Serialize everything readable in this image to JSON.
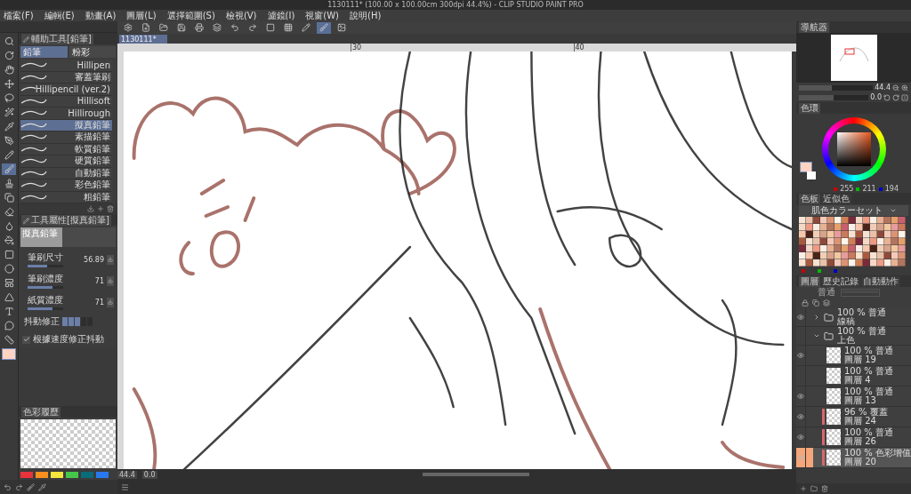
{
  "window": {
    "title": "1130111* (100.00 x 100.00cm 300dpi 44.4%) - CLIP STUDIO PAINT PRO"
  },
  "menu": [
    "檔案(F)",
    "編輯(E)",
    "動畫(A)",
    "圖層(L)",
    "選擇範圍(S)",
    "檢視(V)",
    "濾鏡(I)",
    "視窗(W)",
    "說明(H)"
  ],
  "document_tab": {
    "label": "1130111*"
  },
  "ruler": {
    "marks": [
      "30",
      "40"
    ]
  },
  "sub_tool_panel": {
    "title": "輔助工具[鉛筆]",
    "groups": [
      {
        "label": "鉛筆",
        "selected": true
      },
      {
        "label": "粉彩",
        "selected": false
      }
    ],
    "brushes": [
      {
        "name": "Hillipen",
        "selected": false
      },
      {
        "name": "審蓋筆刷",
        "selected": false
      },
      {
        "name": "Hillipencil (ver.2)",
        "selected": false
      },
      {
        "name": "Hillisoft",
        "selected": false
      },
      {
        "name": "Hillirough",
        "selected": false
      },
      {
        "name": "擬真鉛筆",
        "selected": true
      },
      {
        "name": "素描鉛筆",
        "selected": false
      },
      {
        "name": "軟質鉛筆",
        "selected": false
      },
      {
        "name": "硬質鉛筆",
        "selected": false
      },
      {
        "name": "自動鉛筆",
        "selected": false
      },
      {
        "name": "彩色鉛筆",
        "selected": false
      },
      {
        "name": "粗鉛筆",
        "selected": false
      }
    ]
  },
  "tool_property": {
    "title": "工具屬性[擬真鉛筆]",
    "preview_label": "擬真鉛筆",
    "settings": [
      {
        "kind": "slider",
        "label": "筆刷尺寸",
        "value": "56.89",
        "level": 0.55
      },
      {
        "kind": "slider",
        "label": "筆刷濃度",
        "value": "71",
        "level": 0.71
      },
      {
        "kind": "slider",
        "label": "紙質濃度",
        "value": "71",
        "level": 0.71
      },
      {
        "kind": "stabilizer",
        "label": "抖動修正",
        "level": 0.6
      },
      {
        "kind": "checkbox",
        "label": "根據速度修正抖動",
        "checked": true
      }
    ]
  },
  "color_history": {
    "title": "色彩履歷",
    "swatches": [
      {
        "color": "#e8323c"
      },
      {
        "color": "#f7901e"
      },
      {
        "color": "#f5e63c"
      },
      {
        "color": "#45c84a"
      },
      {
        "color": "#096c78"
      },
      {
        "color": "#2a78f0"
      }
    ]
  },
  "status": {
    "zoom": "44.4",
    "angle": "0.0"
  },
  "navigator": {
    "title": "導航器",
    "zoom": "44.4",
    "angle": "0.0",
    "zoom_slider": {
      "level": 0.45
    },
    "rotate_slider": {
      "level": 0.5
    }
  },
  "color_wheel": {
    "title": "色環",
    "rgb": [
      "255",
      "211",
      "194"
    ]
  },
  "palette": {
    "tabs": [
      {
        "label": "色板",
        "selected": true
      },
      {
        "label": "近似色",
        "selected": false
      }
    ],
    "set_name": "肌色カラーセット"
  },
  "layers": {
    "tabs": [
      {
        "label": "圖層",
        "selected": true
      },
      {
        "label": "歷史記錄",
        "selected": false
      },
      {
        "label": "自動動作",
        "selected": false
      }
    ],
    "blend_mode": "普通",
    "opacity": {
      "level": 1
    },
    "items": [
      {
        "kind": "folder",
        "mode": "100 % 普通",
        "name": "線稿",
        "visible": true,
        "expanded": false,
        "selected": false
      },
      {
        "kind": "folder",
        "mode": "100 % 普通",
        "name": "上色",
        "visible": false,
        "expanded": true,
        "selected": false,
        "children": [
          {
            "kind": "layer",
            "mode": "100 % 普通",
            "name": "圖層 19",
            "visible": true,
            "selected": false
          },
          {
            "kind": "layer",
            "mode": "100 % 普通",
            "name": "圖層 4",
            "visible": false,
            "selected": false
          },
          {
            "kind": "layer",
            "mode": "100 % 普通",
            "name": "圖層 13",
            "visible": true,
            "selected": false
          },
          {
            "kind": "layer",
            "mode": "96 % 覆蓋",
            "name": "圖層 24",
            "visible": true,
            "selected": false,
            "color": "#d9666a"
          },
          {
            "kind": "layer",
            "mode": "100 % 普通",
            "name": "圖層 26",
            "visible": true,
            "selected": false,
            "color": "#d9666a"
          },
          {
            "kind": "layer",
            "mode": "100 % 色彩增值",
            "name": "圖層 20",
            "visible": true,
            "selected": true,
            "color": "#d9666a"
          }
        ]
      }
    ]
  }
}
